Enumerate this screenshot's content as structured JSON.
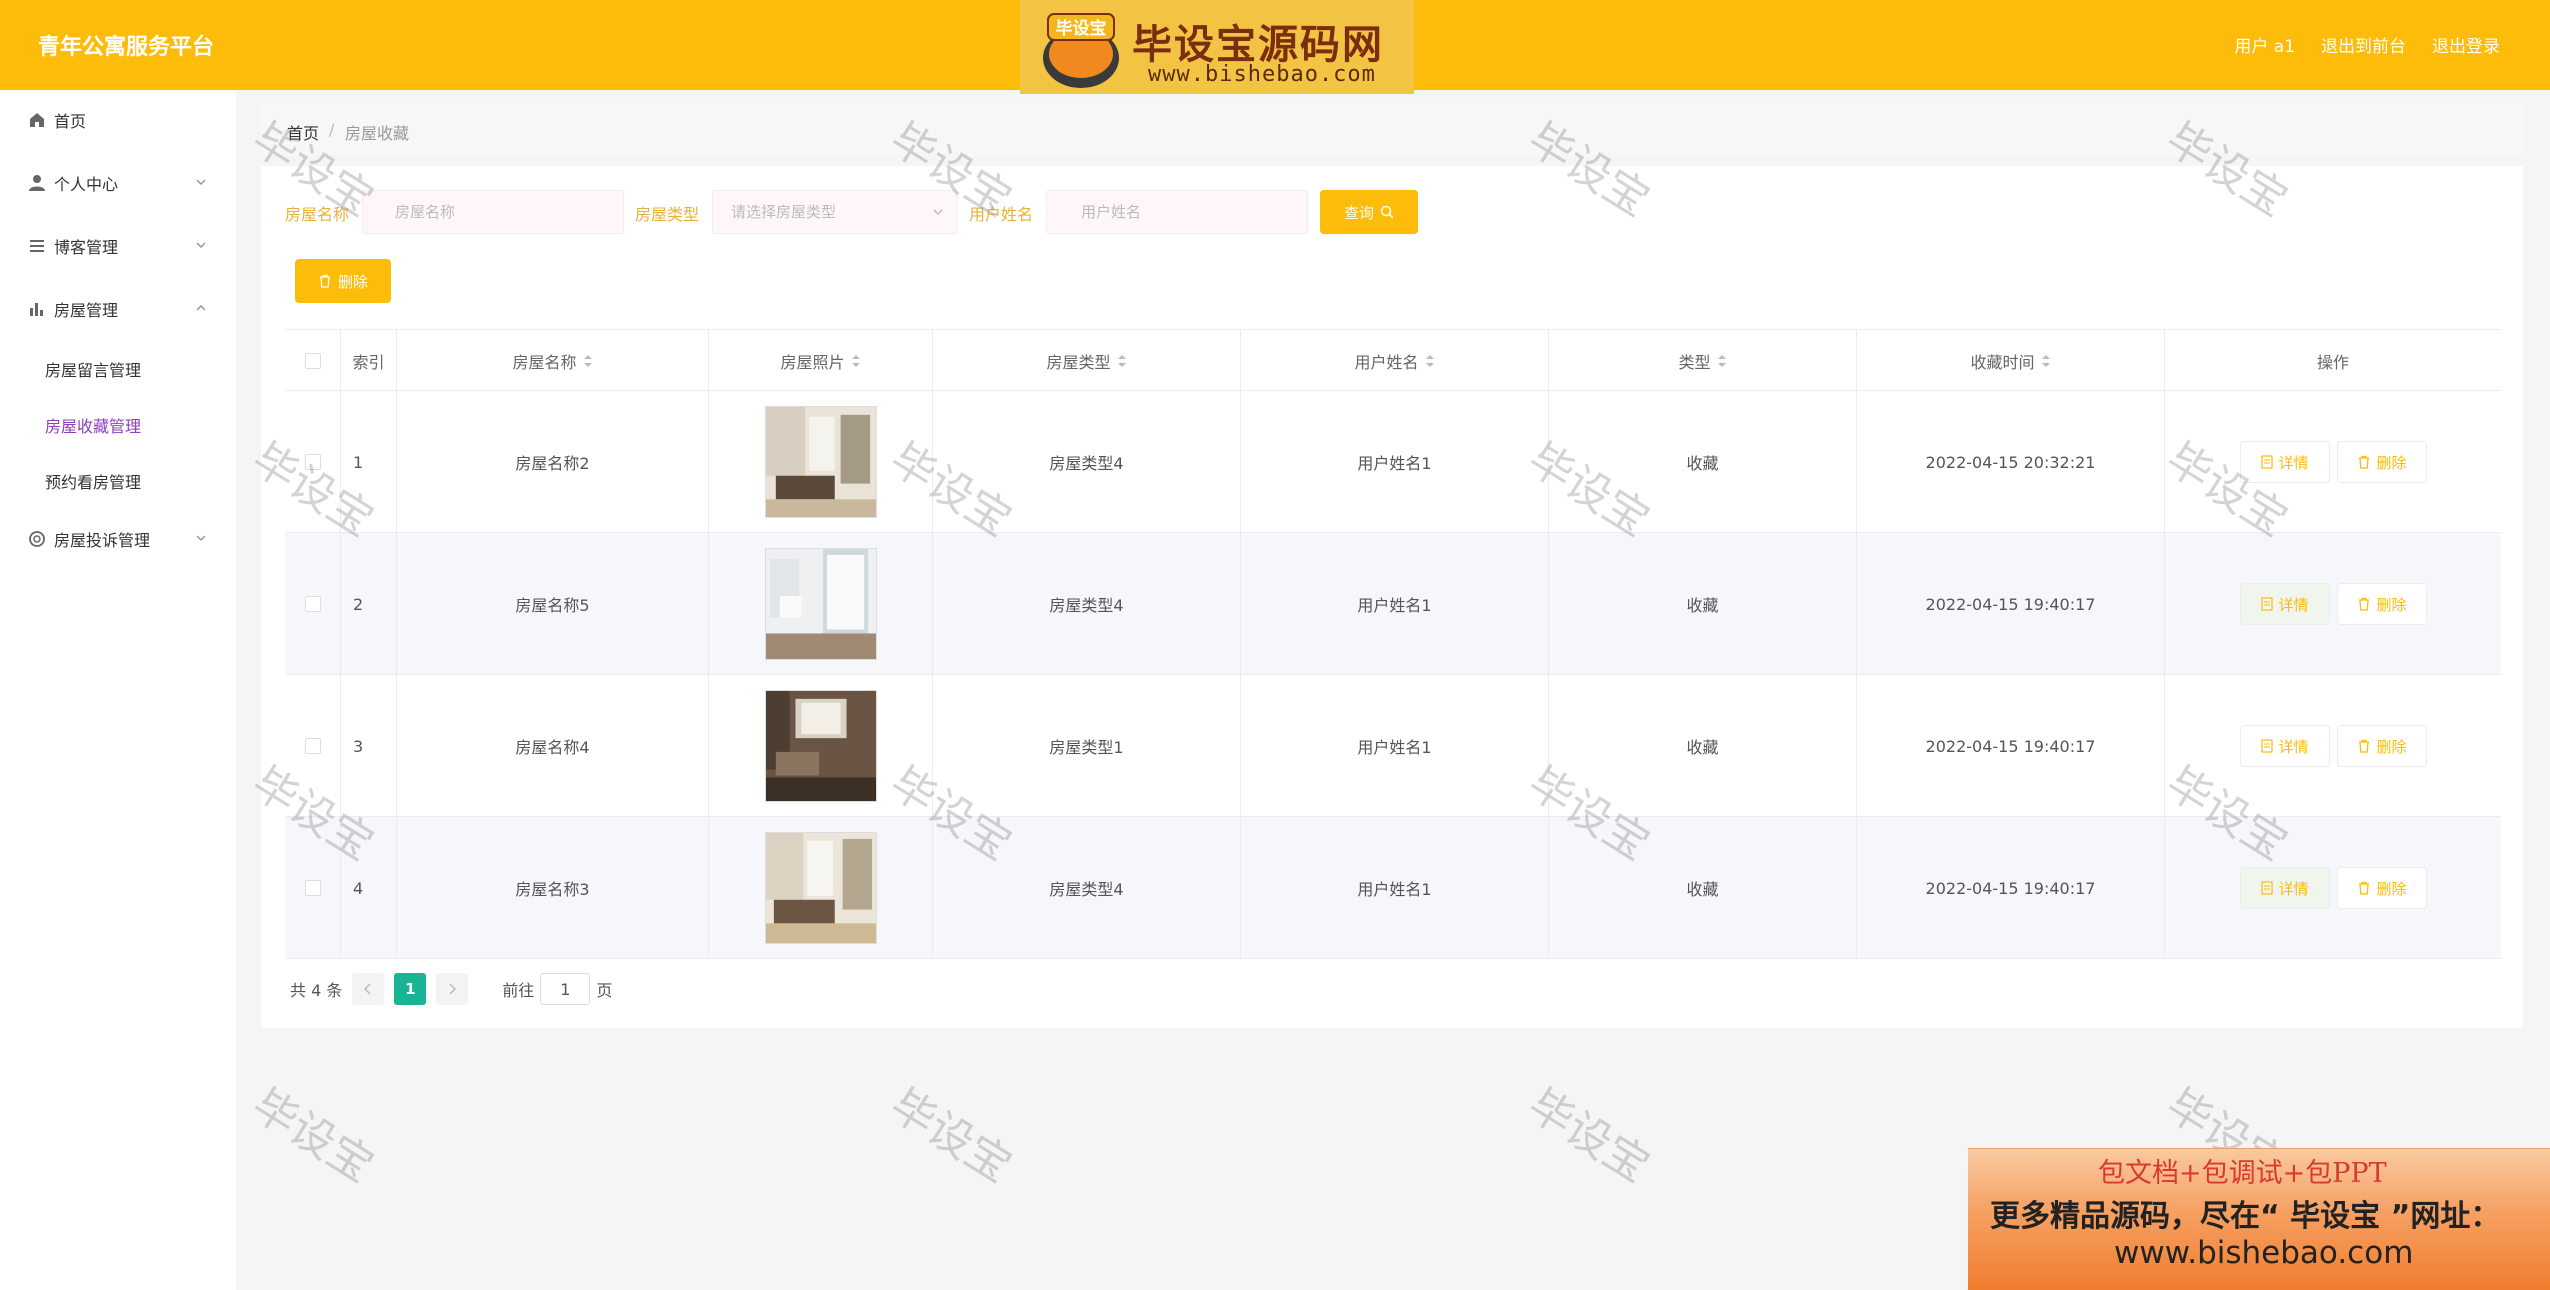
{
  "header": {
    "app_title": "青年公寓服务平台",
    "logo_text": "毕设宝源码网",
    "logo_badge": "毕设宝",
    "logo_url": "www.bishebao.com",
    "user_label": "用户 a1",
    "front_link": "退出到前台",
    "logout_link": "退出登录"
  },
  "sidebar": {
    "home": "首页",
    "personal": "个人中心",
    "blog": "博客管理",
    "house": "房屋管理",
    "house_sub": [
      "房屋留言管理",
      "房屋收藏管理",
      "预约看房管理"
    ],
    "complaint": "房屋投诉管理"
  },
  "breadcrumb": {
    "home": "首页",
    "sep": "/",
    "current": "房屋收藏"
  },
  "search": {
    "name_label": "房屋名称",
    "name_placeholder": "房屋名称",
    "type_label": "房屋类型",
    "type_placeholder": "请选择房屋类型",
    "user_label": "用户姓名",
    "user_placeholder": "用户姓名",
    "query_button": "查询"
  },
  "toolbar": {
    "delete_label": "删除"
  },
  "table": {
    "headers": [
      "索引",
      "房屋名称",
      "房屋照片",
      "房屋类型",
      "用户姓名",
      "类型",
      "收藏时间",
      "操作"
    ],
    "rows": [
      {
        "index": "1",
        "name": "房屋名称2",
        "type": "房屋类型4",
        "user": "用户姓名1",
        "kind": "收藏",
        "time": "2022-04-15 20:32:21"
      },
      {
        "index": "2",
        "name": "房屋名称5",
        "type": "房屋类型4",
        "user": "用户姓名1",
        "kind": "收藏",
        "time": "2022-04-15 19:40:17"
      },
      {
        "index": "3",
        "name": "房屋名称4",
        "type": "房屋类型1",
        "user": "用户姓名1",
        "kind": "收藏",
        "time": "2022-04-15 19:40:17"
      },
      {
        "index": "4",
        "name": "房屋名称3",
        "type": "房屋类型4",
        "user": "用户姓名1",
        "kind": "收藏",
        "time": "2022-04-15 19:40:17"
      }
    ],
    "detail_label": "详情",
    "delete_label": "删除"
  },
  "pagination": {
    "total": "共 4 条",
    "current": "1",
    "goto": "前往",
    "page_value": "1",
    "page_unit": "页"
  },
  "watermark": "毕设宝",
  "ad": {
    "line1": "包文档+包调试+包PPT",
    "line2": "更多精品源码，尽在“ 毕设宝 ”网址：",
    "line3": "www.bishebao.com"
  },
  "colors": {
    "primary": "#fdbb0a",
    "active": "#8e3fbf",
    "page": "#1ab394"
  }
}
